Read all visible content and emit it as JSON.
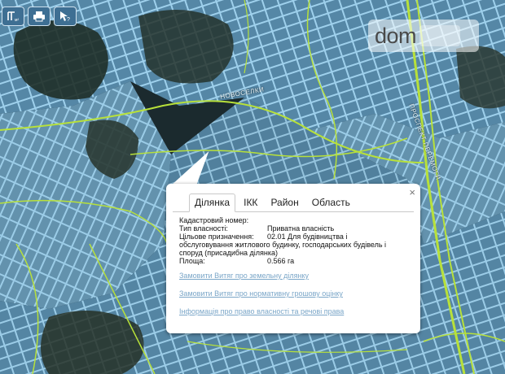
{
  "toolbar": {
    "measure_icon": "ruler-icon",
    "print_icon": "printer-icon",
    "info_icon": "pointer-question-icon"
  },
  "watermark": {
    "text": "dom"
  },
  "map_labels": {
    "street_1": "НОВОСЕЛКИ",
    "street_2": "ПРОСПЕКТ ПЕРЕМОГИ"
  },
  "colors": {
    "parcel_outline": "#8fd3ff",
    "parcel_fill": "#5a8fb0",
    "road_outline": "#b8e13a",
    "background": "#1b2a2e",
    "link": "#7aa6c8"
  },
  "popup": {
    "close": "×",
    "tabs": [
      {
        "label": "Ділянка",
        "active": true
      },
      {
        "label": "ІКК",
        "active": false
      },
      {
        "label": "Район",
        "active": false
      },
      {
        "label": "Область",
        "active": false
      }
    ],
    "fields": {
      "cadastral_label": "Кадастровий номер:",
      "cadastral_value": "",
      "ownership_label": "Тип власності:",
      "ownership_value": "Приватна власність",
      "purpose_label": "Цільове призначення:",
      "purpose_value_line1": "02.01 Для будівництва і",
      "purpose_value_rest": "обслуговування житлового будинку, господарських будівель і споруд (присадибна ділянка)",
      "area_label": "Площа:",
      "area_value": "0.566 га"
    },
    "links": [
      "Замовити Витяг про земельну ділянку",
      "Замовити Витяг про нормативну грошову оцінку",
      "Інформація про право власності та речові права"
    ]
  }
}
